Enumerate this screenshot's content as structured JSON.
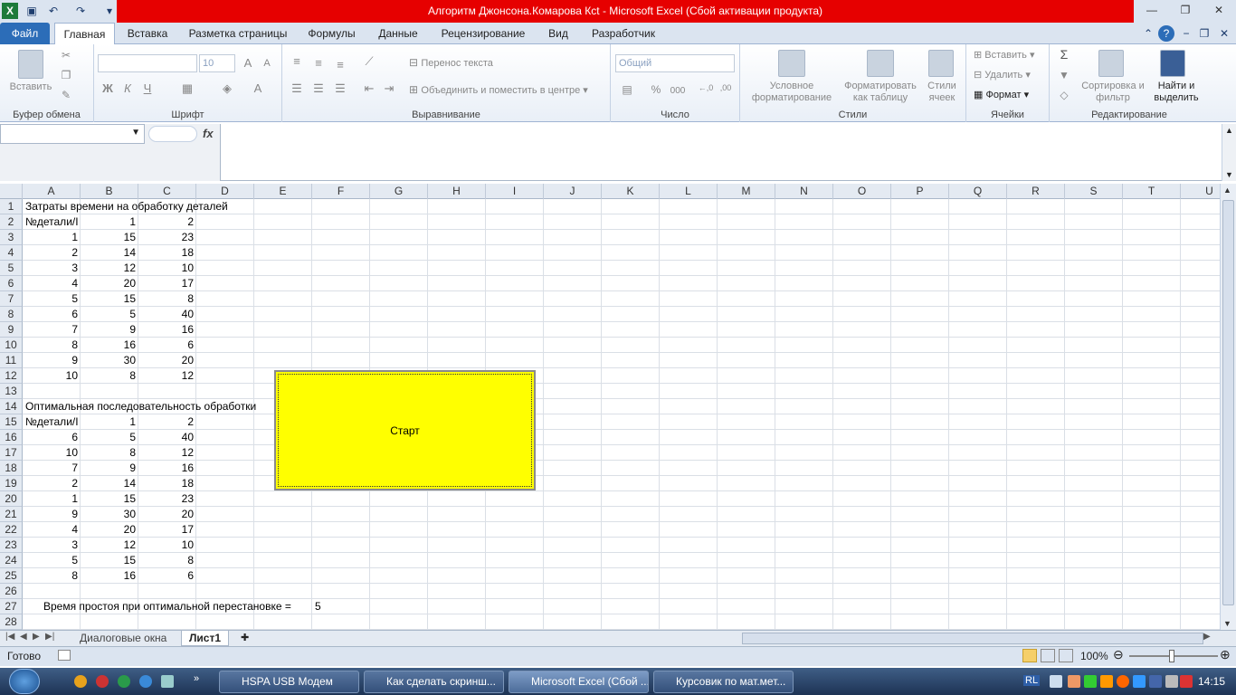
{
  "window": {
    "title": "Алгоритм Джонсона.Комарова Ксt  -  Microsoft Excel (Сбой активации продукта)"
  },
  "ribbon": {
    "tabs": [
      "Файл",
      "Главная",
      "Вставка",
      "Разметка страницы",
      "Формулы",
      "Данные",
      "Рецензирование",
      "Вид",
      "Разработчик"
    ],
    "clipboard": {
      "paste": "Вставить",
      "group": "Буфер обмена"
    },
    "font": {
      "size": "10",
      "bold": "Ж",
      "italic": "К",
      "underline": "Ч",
      "group": "Шрифт"
    },
    "alignment": {
      "wrap": "Перенос текста",
      "merge": "Объединить и поместить в центре",
      "group": "Выравнивание"
    },
    "number": {
      "format": "Общий",
      "percent": "%",
      "thousands": "000",
      "group": "Число"
    },
    "styles": {
      "conditional": "Условное форматирование",
      "as_table": "Форматировать как таблицу",
      "cell_styles": "Стили ячеек",
      "group": "Стили"
    },
    "cells": {
      "insert": "Вставить",
      "delete": "Удалить",
      "format": "Формат",
      "group": "Ячейки"
    },
    "editing": {
      "sum": "Σ",
      "sort": "Сортировка и фильтр",
      "find": "Найти и выделить",
      "group": "Редактирование"
    }
  },
  "formula_bar": {
    "fx": "fx"
  },
  "grid": {
    "columns": [
      "A",
      "B",
      "C",
      "D",
      "E",
      "F",
      "G",
      "H",
      "I",
      "J",
      "K",
      "L",
      "M",
      "N",
      "O",
      "P",
      "Q",
      "R",
      "S",
      "T",
      "U"
    ],
    "rows": [
      "1",
      "2",
      "3",
      "4",
      "5",
      "6",
      "7",
      "8",
      "9",
      "10",
      "11",
      "12",
      "13",
      "14",
      "15",
      "16",
      "17",
      "18",
      "19",
      "20",
      "21",
      "22",
      "23",
      "24",
      "25",
      "26",
      "27",
      "28"
    ],
    "cells": {
      "A1": "Затраты времени на обработку деталей",
      "A2": "№детали/I",
      "B2": "1",
      "C2": "2",
      "A3": "1",
      "B3": "15",
      "C3": "23",
      "A4": "2",
      "B4": "14",
      "C4": "18",
      "A5": "3",
      "B5": "12",
      "C5": "10",
      "A6": "4",
      "B6": "20",
      "C6": "17",
      "A7": "5",
      "B7": "15",
      "C7": "8",
      "A8": "6",
      "B8": "5",
      "C8": "40",
      "A9": "7",
      "B9": "9",
      "C9": "16",
      "A10": "8",
      "B10": "16",
      "C10": "6",
      "A11": "9",
      "B11": "30",
      "C11": "20",
      "A12": "10",
      "B12": "8",
      "C12": "12",
      "A14": "Оптимальная последовательность обработки",
      "A15": "№детали/I",
      "B15": "1",
      "C15": "2",
      "A16": "6",
      "B16": "5",
      "C16": "40",
      "A17": "10",
      "B17": "8",
      "C17": "12",
      "A18": "7",
      "B18": "9",
      "C18": "16",
      "A19": "2",
      "B19": "14",
      "C19": "18",
      "A20": "1",
      "B20": "15",
      "C20": "23",
      "A21": "9",
      "B21": "30",
      "C21": "20",
      "A22": "4",
      "B22": "20",
      "C22": "17",
      "A23": "3",
      "B23": "12",
      "C23": "10",
      "A24": "5",
      "B24": "15",
      "C24": "8",
      "A25": "8",
      "B25": "16",
      "C25": "6",
      "A27": "Время простоя при оптимальной перестановке =",
      "F27": "5"
    },
    "start_button": "Старт"
  },
  "sheets": {
    "tabs": [
      "Диалоговые окна",
      "Лист1"
    ],
    "active": "Лист1"
  },
  "status": {
    "ready": "Готово",
    "zoom": "100%"
  },
  "taskbar": {
    "items": [
      "HSPA USB Модем",
      "Как сделать скринш...",
      "Microsoft Excel (Сбой ...",
      "Курсовик по мат.мет..."
    ],
    "lang": "RL",
    "time": "14:15"
  },
  "colors": {
    "title_bar": "#e60000",
    "button_fill": "#ffff00",
    "file_tab": "#2c6db8"
  }
}
